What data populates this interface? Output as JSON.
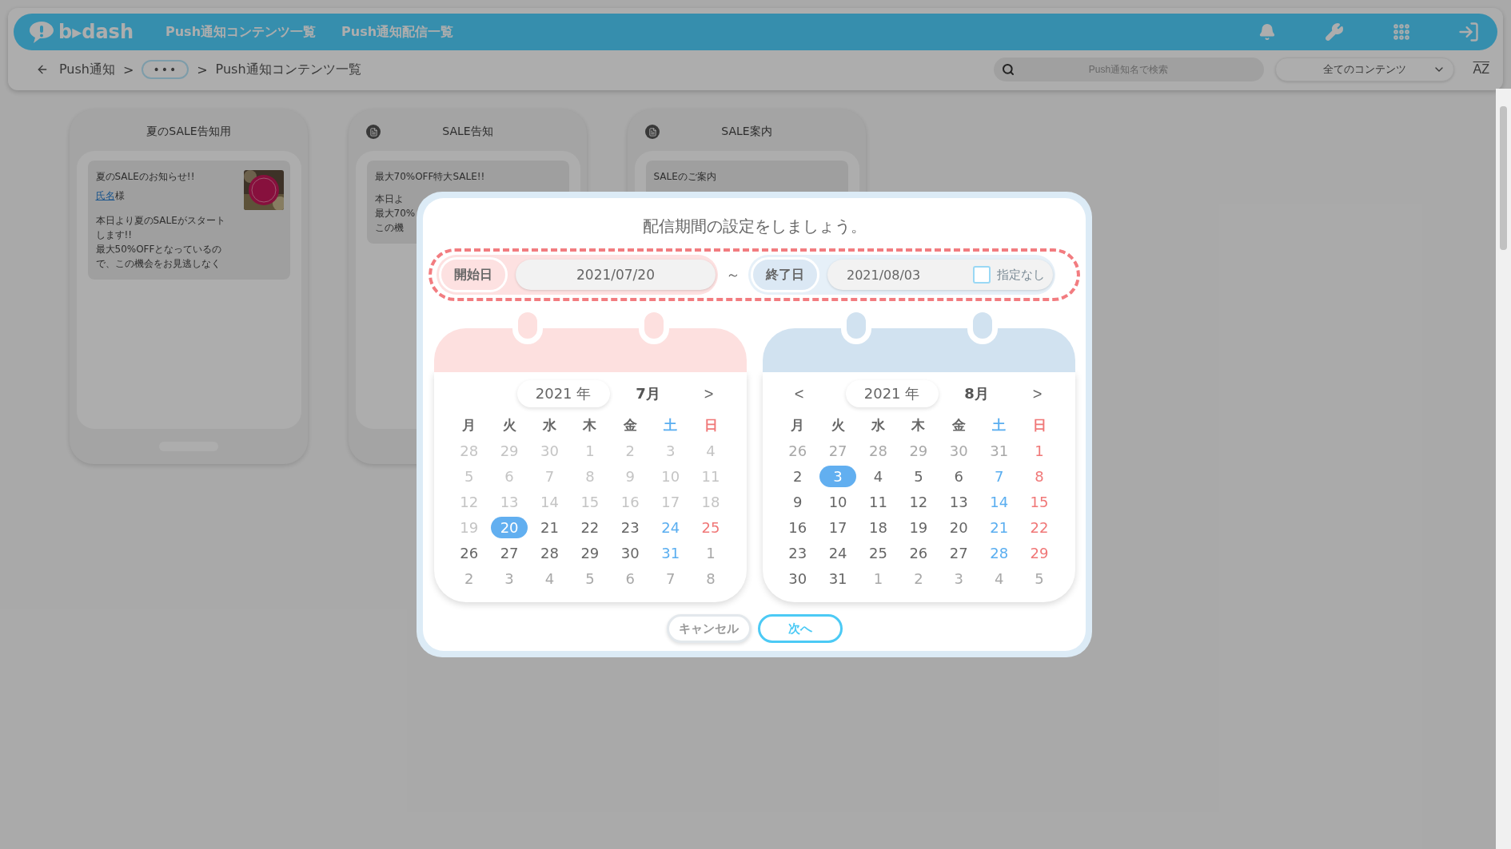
{
  "header": {
    "logo": "b▸dash",
    "nav": [
      {
        "label": "Push通知コンテンツ一覧"
      },
      {
        "label": "Push通知配信一覧"
      }
    ]
  },
  "breadcrumb": [
    {
      "kind": "link",
      "label": "Push通知"
    },
    {
      "kind": "sep",
      "label": ">"
    },
    {
      "kind": "more",
      "label": "•••"
    },
    {
      "kind": "sep",
      "label": ">"
    },
    {
      "kind": "current",
      "label": "Push通知コンテンツ一覧"
    }
  ],
  "search": {
    "placeholder": "Push通知名で検索"
  },
  "filter": {
    "value": "全てのコンテンツ"
  },
  "sort": {
    "label": "AZ"
  },
  "cards": [
    {
      "title": "夏のSALE告知用",
      "preview": {
        "subject": "夏のSALEのお知らせ!!",
        "name_link": "氏名",
        "name_suffix": "様",
        "body_lines": [
          "本日より夏のSALEがスタート",
          "します!!",
          "最大50%OFFとなっているの",
          "で、この機会をお見逃しなく"
        ],
        "picture": true
      }
    },
    {
      "title": "SALE告知",
      "preview": {
        "subject": "最大70%OFF特大SALE!!",
        "body_lines": [
          "本日よ",
          "最大70%",
          "この機"
        ]
      }
    },
    {
      "title": "SALE案内",
      "preview": {
        "subject": "SALEのご案内"
      }
    }
  ],
  "modal": {
    "title": "配信期間の設定をしましょう。",
    "start": {
      "label": "開始日",
      "value": "2021/07/20"
    },
    "separator": "～",
    "end": {
      "label": "終了日",
      "value": "2021/08/03"
    },
    "no_end": {
      "label": "指定なし",
      "checked": false
    },
    "calendars": [
      {
        "year": "2021 年",
        "month": "7月",
        "next": ">",
        "weekdays": [
          {
            "label": "月",
            "kind": "weekday"
          },
          {
            "label": "火",
            "kind": "weekday"
          },
          {
            "label": "水",
            "kind": "weekday"
          },
          {
            "label": "木",
            "kind": "weekday"
          },
          {
            "label": "金",
            "kind": "weekday"
          },
          {
            "label": "土",
            "kind": "sat"
          },
          {
            "label": "日",
            "kind": "sun"
          }
        ],
        "weeks": [
          [
            {
              "d": "28",
              "kind": "disabled",
              "selected": false
            },
            {
              "d": "29",
              "kind": "disabled",
              "selected": false
            },
            {
              "d": "30",
              "kind": "disabled",
              "selected": false
            },
            {
              "d": "1",
              "kind": "disabled",
              "selected": false
            },
            {
              "d": "2",
              "kind": "disabled",
              "selected": false
            },
            {
              "d": "3",
              "kind": "disabled",
              "selected": false
            },
            {
              "d": "4",
              "kind": "disabled",
              "selected": false
            }
          ],
          [
            {
              "d": "5",
              "kind": "disabled",
              "selected": false
            },
            {
              "d": "6",
              "kind": "disabled",
              "selected": false
            },
            {
              "d": "7",
              "kind": "disabled",
              "selected": false
            },
            {
              "d": "8",
              "kind": "disabled",
              "selected": false
            },
            {
              "d": "9",
              "kind": "disabled",
              "selected": false
            },
            {
              "d": "10",
              "kind": "disabled",
              "selected": false
            },
            {
              "d": "11",
              "kind": "disabled",
              "selected": false
            }
          ],
          [
            {
              "d": "12",
              "kind": "disabled",
              "selected": false
            },
            {
              "d": "13",
              "kind": "disabled",
              "selected": false
            },
            {
              "d": "14",
              "kind": "disabled",
              "selected": false
            },
            {
              "d": "15",
              "kind": "disabled",
              "selected": false
            },
            {
              "d": "16",
              "kind": "disabled",
              "selected": false
            },
            {
              "d": "17",
              "kind": "disabled",
              "selected": false
            },
            {
              "d": "18",
              "kind": "disabled",
              "selected": false
            }
          ],
          [
            {
              "d": "19",
              "kind": "disabled",
              "selected": false
            },
            {
              "d": "20",
              "kind": "weekday",
              "selected": true
            },
            {
              "d": "21",
              "kind": "weekday",
              "selected": false
            },
            {
              "d": "22",
              "kind": "weekday",
              "selected": false
            },
            {
              "d": "23",
              "kind": "weekday",
              "selected": false
            },
            {
              "d": "24",
              "kind": "sat",
              "selected": false
            },
            {
              "d": "25",
              "kind": "sun",
              "selected": false
            }
          ],
          [
            {
              "d": "26",
              "kind": "weekday",
              "selected": false
            },
            {
              "d": "27",
              "kind": "weekday",
              "selected": false
            },
            {
              "d": "28",
              "kind": "weekday",
              "selected": false
            },
            {
              "d": "29",
              "kind": "weekday",
              "selected": false
            },
            {
              "d": "30",
              "kind": "weekday",
              "selected": false
            },
            {
              "d": "31",
              "kind": "sat",
              "selected": false
            },
            {
              "d": "1",
              "kind": "other",
              "selected": false
            }
          ],
          [
            {
              "d": "2",
              "kind": "other",
              "selected": false
            },
            {
              "d": "3",
              "kind": "other",
              "selected": false
            },
            {
              "d": "4",
              "kind": "other",
              "selected": false
            },
            {
              "d": "5",
              "kind": "other",
              "selected": false
            },
            {
              "d": "6",
              "kind": "other",
              "selected": false
            },
            {
              "d": "7",
              "kind": "other",
              "selected": false
            },
            {
              "d": "8",
              "kind": "other",
              "selected": false
            }
          ]
        ]
      },
      {
        "prev": "<",
        "year": "2021 年",
        "month": "8月",
        "next": ">",
        "weekdays": [
          {
            "label": "月",
            "kind": "weekday"
          },
          {
            "label": "火",
            "kind": "weekday"
          },
          {
            "label": "水",
            "kind": "weekday"
          },
          {
            "label": "木",
            "kind": "weekday"
          },
          {
            "label": "金",
            "kind": "weekday"
          },
          {
            "label": "土",
            "kind": "sat"
          },
          {
            "label": "日",
            "kind": "sun"
          }
        ],
        "weeks": [
          [
            {
              "d": "26",
              "kind": "other",
              "selected": false
            },
            {
              "d": "27",
              "kind": "other",
              "selected": false
            },
            {
              "d": "28",
              "kind": "other",
              "selected": false
            },
            {
              "d": "29",
              "kind": "other",
              "selected": false
            },
            {
              "d": "30",
              "kind": "other",
              "selected": false
            },
            {
              "d": "31",
              "kind": "other",
              "selected": false
            },
            {
              "d": "1",
              "kind": "sun",
              "selected": false
            }
          ],
          [
            {
              "d": "2",
              "kind": "weekday",
              "selected": false
            },
            {
              "d": "3",
              "kind": "weekday",
              "selected": true
            },
            {
              "d": "4",
              "kind": "weekday",
              "selected": false
            },
            {
              "d": "5",
              "kind": "weekday",
              "selected": false
            },
            {
              "d": "6",
              "kind": "weekday",
              "selected": false
            },
            {
              "d": "7",
              "kind": "sat",
              "selected": false
            },
            {
              "d": "8",
              "kind": "sun",
              "selected": false
            }
          ],
          [
            {
              "d": "9",
              "kind": "weekday",
              "selected": false
            },
            {
              "d": "10",
              "kind": "weekday",
              "selected": false
            },
            {
              "d": "11",
              "kind": "weekday",
              "selected": false
            },
            {
              "d": "12",
              "kind": "weekday",
              "selected": false
            },
            {
              "d": "13",
              "kind": "weekday",
              "selected": false
            },
            {
              "d": "14",
              "kind": "sat",
              "selected": false
            },
            {
              "d": "15",
              "kind": "sun",
              "selected": false
            }
          ],
          [
            {
              "d": "16",
              "kind": "weekday",
              "selected": false
            },
            {
              "d": "17",
              "kind": "weekday",
              "selected": false
            },
            {
              "d": "18",
              "kind": "weekday",
              "selected": false
            },
            {
              "d": "19",
              "kind": "weekday",
              "selected": false
            },
            {
              "d": "20",
              "kind": "weekday",
              "selected": false
            },
            {
              "d": "21",
              "kind": "sat",
              "selected": false
            },
            {
              "d": "22",
              "kind": "sun",
              "selected": false
            }
          ],
          [
            {
              "d": "23",
              "kind": "weekday",
              "selected": false
            },
            {
              "d": "24",
              "kind": "weekday",
              "selected": false
            },
            {
              "d": "25",
              "kind": "weekday",
              "selected": false
            },
            {
              "d": "26",
              "kind": "weekday",
              "selected": false
            },
            {
              "d": "27",
              "kind": "weekday",
              "selected": false
            },
            {
              "d": "28",
              "kind": "sat",
              "selected": false
            },
            {
              "d": "29",
              "kind": "sun",
              "selected": false
            }
          ],
          [
            {
              "d": "30",
              "kind": "weekday",
              "selected": false
            },
            {
              "d": "31",
              "kind": "weekday",
              "selected": false
            },
            {
              "d": "1",
              "kind": "other",
              "selected": false
            },
            {
              "d": "2",
              "kind": "other",
              "selected": false
            },
            {
              "d": "3",
              "kind": "other",
              "selected": false
            },
            {
              "d": "4",
              "kind": "other",
              "selected": false
            },
            {
              "d": "5",
              "kind": "other",
              "selected": false
            }
          ]
        ]
      }
    ],
    "buttons": [
      {
        "label": "キャンセル",
        "kind": "secondary"
      },
      {
        "label": "次へ",
        "kind": "primary"
      }
    ]
  }
}
